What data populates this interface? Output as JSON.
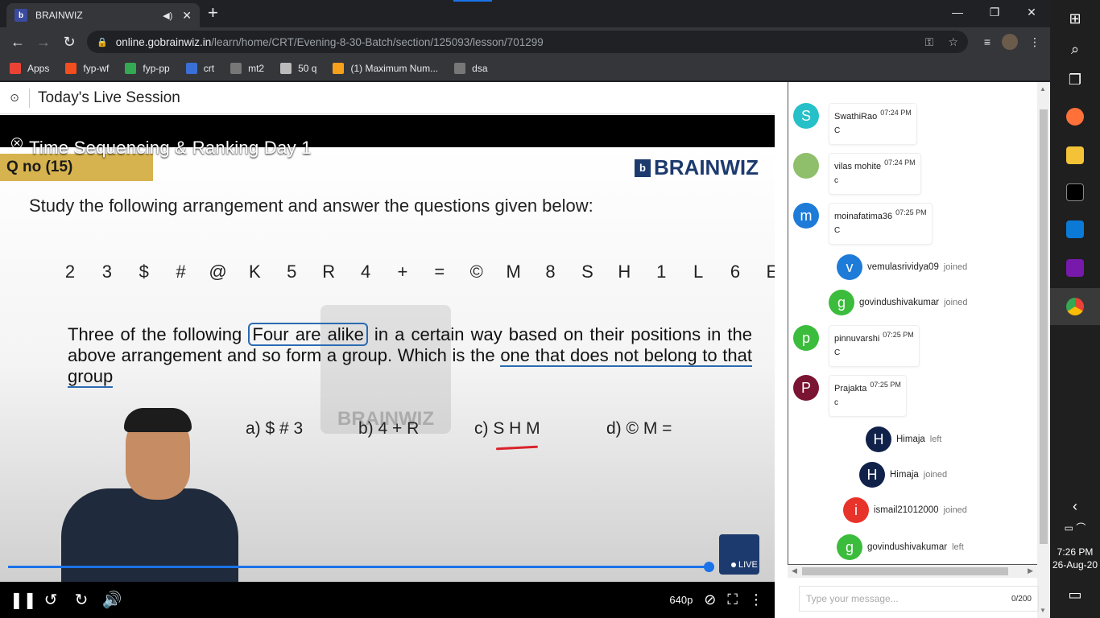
{
  "browser": {
    "tab_title": "BRAINWIZ",
    "tab_favicon": "b",
    "url_host": "online.gobrainwiz.in",
    "url_path": "/learn/home/CRT/Evening-8-30-Batch/section/125093/lesson/701299",
    "bookmarks": [
      {
        "label": "Apps",
        "icon": "apps-icon",
        "color": "#ea4335"
      },
      {
        "label": "fyp-wf",
        "icon": "figma-icon",
        "color": "#f24e1e"
      },
      {
        "label": "fyp-pp",
        "icon": "image-icon",
        "color": "#34a853"
      },
      {
        "label": "crt",
        "icon": "brainwiz-icon",
        "color": "#3a6fd8"
      },
      {
        "label": "mt2",
        "icon": "cc-icon",
        "color": "#777777"
      },
      {
        "label": "50 q",
        "icon": "globe-icon",
        "color": "#bbbbbb"
      },
      {
        "label": "(1) Maximum Num...",
        "icon": "leetcode-icon",
        "color": "#f89f1b"
      },
      {
        "label": "dsa",
        "icon": "cc-icon",
        "color": "#777777"
      }
    ]
  },
  "page": {
    "title": "Today's Live Session"
  },
  "video": {
    "title": "Time Sequencing & Ranking Day 1",
    "question_no": "Q no (15)",
    "brand": "BRAINWIZ",
    "instruction": "Study the following arrangement and answer the questions given below:",
    "sequence": [
      "2",
      "3",
      "$",
      "#",
      "@",
      "K",
      "5",
      "R",
      "4",
      "+",
      "=",
      "©",
      "M",
      "8",
      "S",
      "H",
      "1",
      "L",
      "6",
      "E"
    ],
    "para_pre": "Three of the following ",
    "para_boxed": "Four are alike",
    "para_mid": " in a certain way based on their positions in the above arrangement and so form a group. Which is the ",
    "para_under": "one that does not belong to that group",
    "options": [
      "a) $ # 3",
      "b) 4 + R",
      "c) S H M",
      "d) © M ="
    ],
    "watermark": "BRAINWIZ",
    "live_label": "LIVE",
    "quality": "640p",
    "progress": 0.91
  },
  "chat": {
    "messages": [
      {
        "type": "msg",
        "name": "SwathiRao",
        "time": "07:24 PM",
        "text": "C",
        "initial": "S",
        "color": "#26c0c9"
      },
      {
        "type": "msg",
        "name": "vilas mohite",
        "time": "07:24 PM",
        "text": "c",
        "initial": "",
        "color": "#8fbf6a"
      },
      {
        "type": "msg",
        "name": "moinafatima36",
        "time": "07:25 PM",
        "text": "C",
        "initial": "m",
        "color": "#1e7bd8"
      },
      {
        "type": "event",
        "name": "vemulasrividya09",
        "action": "joined",
        "initial": "v",
        "color": "#1e7bd8"
      },
      {
        "type": "event",
        "name": "govindushivakumar",
        "action": "joined",
        "initial": "g",
        "color": "#3cbc3c"
      },
      {
        "type": "msg",
        "name": "pinnuvarshi",
        "time": "07:25 PM",
        "text": "C",
        "initial": "p",
        "color": "#3cbc3c"
      },
      {
        "type": "msg",
        "name": "Prajakta",
        "time": "07:25 PM",
        "text": "c",
        "initial": "P",
        "color": "#7a1433"
      },
      {
        "type": "event",
        "name": "Himaja",
        "action": "left",
        "initial": "H",
        "color": "#10224a"
      },
      {
        "type": "event",
        "name": "Himaja",
        "action": "joined",
        "initial": "H",
        "color": "#10224a"
      },
      {
        "type": "event",
        "name": "ismail21012000",
        "action": "joined",
        "initial": "i",
        "color": "#e8332b"
      },
      {
        "type": "event",
        "name": "govindushivakumar",
        "action": "left",
        "initial": "g",
        "color": "#3cbc3c"
      }
    ],
    "input_placeholder": "Type your message...",
    "counter": "0/200"
  },
  "taskbar": {
    "time": "7:26 PM",
    "date": "26-Aug-20"
  }
}
